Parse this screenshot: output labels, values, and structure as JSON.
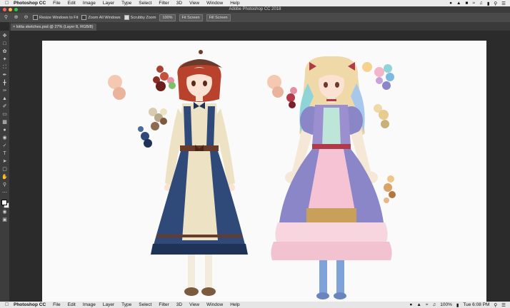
{
  "menubar_top": {
    "app": "Photoshop CC",
    "items": [
      "File",
      "Edit",
      "Image",
      "Layer",
      "Type",
      "Select",
      "Filter",
      "3D",
      "View",
      "Window",
      "Help"
    ]
  },
  "menubar_bottom": {
    "app": "Photoshop CC",
    "items": [
      "File",
      "Edit",
      "Image",
      "Layer",
      "Type",
      "Select",
      "Filter",
      "3D",
      "View",
      "Window",
      "Help"
    ],
    "battery": "100%",
    "clock": "Tue 6:08 PM"
  },
  "window": {
    "title": "Adobe Photoshop CC 2018"
  },
  "options": {
    "resize_windows": "Resize Windows to Fit",
    "zoom_all": "Zoom All Windows",
    "scrubby": "Scrubby Zoom",
    "zoom_pct": "100%",
    "fit_screen": "Fit Screen",
    "fill_screen": "Fill Screen"
  },
  "document": {
    "tab": "lolita sketches.psd @ 27% (Layer 8, RGB/8)"
  },
  "colors": {
    "canvas": "#fafafa",
    "navy": "#2f4a78",
    "cream": "#ede3c4",
    "brown": "#6a3a2a",
    "red_hair": "#b8422c",
    "lavender": "#8a86c8",
    "pink": "#f3b6c9",
    "blonde": "#efd9a8"
  }
}
